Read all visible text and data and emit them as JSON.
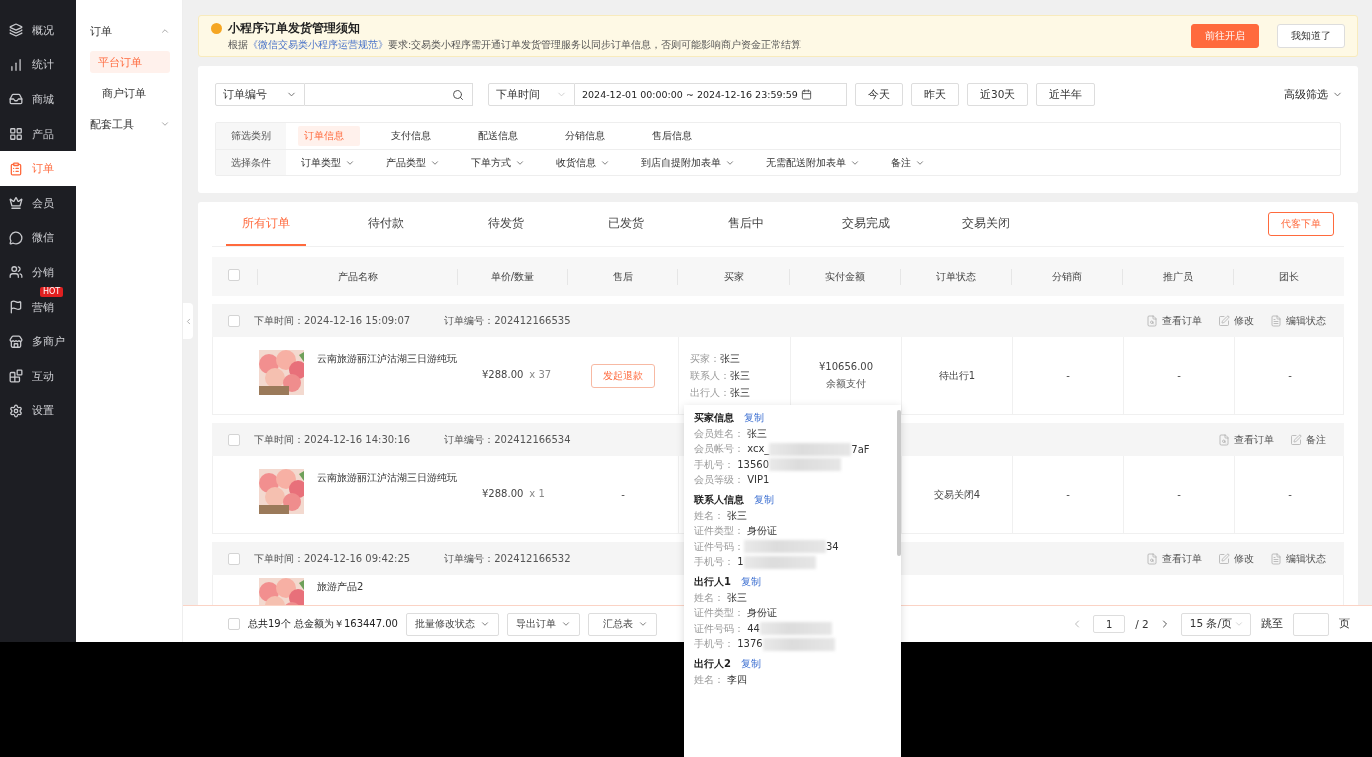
{
  "sidebar": {
    "items": [
      {
        "label": "概况",
        "selected": false
      },
      {
        "label": "统计",
        "selected": false
      },
      {
        "label": "商城",
        "selected": false
      },
      {
        "label": "产品",
        "selected": false
      },
      {
        "label": "订单",
        "selected": true
      },
      {
        "label": "会员",
        "selected": false
      },
      {
        "label": "微信",
        "selected": false
      },
      {
        "label": "分销",
        "selected": false
      },
      {
        "label": "营销",
        "selected": false,
        "badge": "HOT"
      },
      {
        "label": "多商户",
        "selected": false
      },
      {
        "label": "互动",
        "selected": false
      },
      {
        "label": "设置",
        "selected": false
      }
    ]
  },
  "submenu": {
    "groups": [
      {
        "label": "订单",
        "expanded": true,
        "items": [
          {
            "label": "平台订单",
            "selected": true
          },
          {
            "label": "商户订单",
            "selected": false
          }
        ]
      },
      {
        "label": "配套工具",
        "expanded": false
      }
    ]
  },
  "notice": {
    "title": "小程序订单发货管理须知",
    "text_before": "根据",
    "link": "《微信交易类小程序运营规范》",
    "text_after": "要求:交易类小程序需开通订单发货管理服务以同步订单信息，否则可能影响商户资金正常结算",
    "buttons": [
      {
        "label": "前往开启",
        "kind": "primary"
      },
      {
        "label": "我知道了",
        "kind": "default"
      }
    ]
  },
  "search": {
    "field_select": "订单编号",
    "time_select": "下单时间",
    "date_start": "2024-12-01 00:00:00",
    "date_separator": "~",
    "date_end": "2024-12-16 23:59:59",
    "quick_ranges": [
      "今天",
      "昨天",
      "近30天",
      "近半年"
    ],
    "advanced": "高级筛选"
  },
  "filters": {
    "category_label": "筛选类别",
    "categories": [
      {
        "label": "订单信息",
        "selected": true
      },
      {
        "label": "支付信息",
        "selected": false
      },
      {
        "label": "配送信息",
        "selected": false
      },
      {
        "label": "分销信息",
        "selected": false
      },
      {
        "label": "售后信息",
        "selected": false
      }
    ],
    "condition_label": "选择条件",
    "conditions": [
      "订单类型",
      "产品类型",
      "下单方式",
      "收货信息",
      "到店自提附加表单",
      "无需配送附加表单",
      "备注"
    ]
  },
  "order_tabs": [
    {
      "label": "所有订单",
      "selected": true
    },
    {
      "label": "待付款",
      "selected": false
    },
    {
      "label": "待发货",
      "selected": false
    },
    {
      "label": "已发货",
      "selected": false
    },
    {
      "label": "售后中",
      "selected": false
    },
    {
      "label": "交易完成",
      "selected": false
    },
    {
      "label": "交易关闭",
      "selected": false
    }
  ],
  "proxy_order_button": "代客下单",
  "table": {
    "select_all": false,
    "columns": [
      "产品名称",
      "单价/数量",
      "售后",
      "买家",
      "实付金额",
      "订单状态",
      "分销商",
      "推广员",
      "团长"
    ]
  },
  "orders": [
    {
      "checked": false,
      "time_label": "下单时间：",
      "time": "2024-12-16 15:09:07",
      "number_label": "订单编号：",
      "number": "202412166535",
      "actions": [
        {
          "kind": "view",
          "label": "查看订单"
        },
        {
          "kind": "edit",
          "label": "修改"
        },
        {
          "kind": "status",
          "label": "编辑状态"
        }
      ],
      "product": "云南旅游丽江泸沽湖三日游纯玩",
      "price": "¥288.00",
      "quantity": "x 37",
      "after_sale": {
        "kind": "button",
        "label": "发起退款"
      },
      "buyer": [
        {
          "label": "买家：",
          "value": "张三"
        },
        {
          "label": "联系人：",
          "value": "张三"
        },
        {
          "label": "出行人：",
          "value": "张三"
        }
      ],
      "paid": "¥10656.00",
      "payment": "余额支付",
      "status": "待出行1",
      "distributor": "-",
      "promoter": "-",
      "leader": "-"
    },
    {
      "checked": false,
      "time_label": "下单时间：",
      "time": "2024-12-16 14:30:16",
      "number_label": "订单编号：",
      "number": "202412166534",
      "actions": [
        {
          "kind": "view",
          "label": "查看订单"
        },
        {
          "kind": "edit",
          "label": "备注"
        }
      ],
      "product": "云南旅游丽江泸沽湖三日游纯玩",
      "price": "¥288.00",
      "quantity": "x 1",
      "after_sale": {
        "kind": "text",
        "label": "-"
      },
      "status": "交易关闭4",
      "distributor": "-",
      "promoter": "-",
      "leader": "-"
    },
    {
      "checked": false,
      "time_label": "下单时间：",
      "time": "2024-12-16 09:42:25",
      "number_label": "订单编号：",
      "number": "202412166532",
      "actions": [
        {
          "kind": "view",
          "label": "查看订单"
        },
        {
          "kind": "edit",
          "label": "修改"
        },
        {
          "kind": "status",
          "label": "编辑状态"
        }
      ],
      "product": "旅游产品2"
    }
  ],
  "footer": {
    "select_all": false,
    "summary": "总共19个  总金额为￥163447.00",
    "bulk_buttons": [
      "批量修改状态",
      "导出订单",
      "汇总表"
    ],
    "pagination": {
      "page": "1",
      "total": "/ 2",
      "page_size": "15 条/页",
      "jump_label": "跳至",
      "page_unit": "页"
    }
  },
  "popover": {
    "sections": [
      {
        "title": "买家信息",
        "copy": "复制",
        "lines": [
          {
            "label": "会员姓名：",
            "value": "张三"
          },
          {
            "label": "会员帐号：",
            "value": "xcx_",
            "redacted": true,
            "value_end": "7aF"
          },
          {
            "label": "手机号：",
            "value": "13560",
            "redacted": true
          },
          {
            "label": "会员等级：",
            "value": "VIP1"
          }
        ]
      },
      {
        "title": "联系人信息",
        "copy": "复制",
        "lines": [
          {
            "label": "姓名：",
            "value": "张三"
          },
          {
            "label": "证件类型：",
            "value": "身份证"
          },
          {
            "label": "证件号码：",
            "redacted": true,
            "value_end": "34"
          },
          {
            "label": "手机号：",
            "value": "1",
            "redacted": true
          }
        ]
      },
      {
        "title": "出行人1",
        "copy": "复制",
        "lines": [
          {
            "label": "姓名：",
            "value": "张三"
          },
          {
            "label": "证件类型：",
            "value": "身份证"
          },
          {
            "label": "证件号码：",
            "value": "44",
            "redacted": true
          },
          {
            "label": "手机号：",
            "value": "1376",
            "redacted": true
          }
        ]
      },
      {
        "title": "出行人2",
        "copy": "复制",
        "lines": [
          {
            "label": "姓名：",
            "value": "李四"
          }
        ]
      }
    ]
  }
}
